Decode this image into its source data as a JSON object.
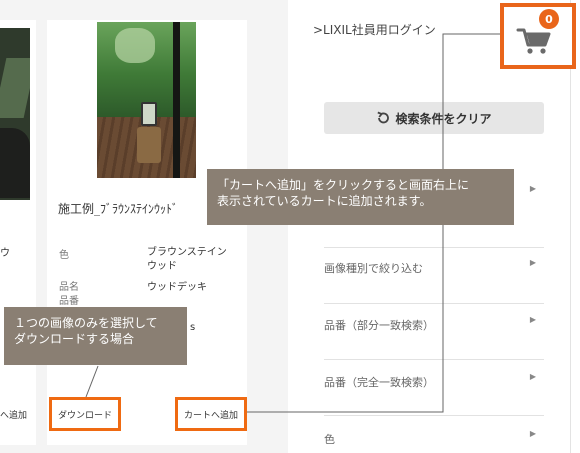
{
  "header": {
    "login_link": ">LIXIL社員用ログイン"
  },
  "cart": {
    "count": "0",
    "icon": "cart-icon",
    "accent_color": "#e9651a"
  },
  "sidebar": {
    "clear_button": "検索条件をクリア",
    "filters": [
      {
        "label": ""
      },
      {
        "label": "画像種別で絞り込む"
      },
      {
        "label": "品番（部分一致検索）"
      },
      {
        "label": "品番（完全一致検索）"
      },
      {
        "label": "色"
      }
    ]
  },
  "product": {
    "title": "施工例_ﾌﾞﾗｳﾝｽﾃｲﾝｳｯﾄﾞ",
    "specs": [
      {
        "label": "色",
        "value": "ブラウンステイン\nウッド"
      },
      {
        "label": "品名",
        "value": "ウッドデッキ"
      },
      {
        "label": "品番",
        "value": ""
      }
    ],
    "trailing_text": "s",
    "download_button": "ダウンロード",
    "add_to_cart_button": "カートへ追加"
  },
  "left_card": {
    "partial_label": "ウ",
    "partial_button": "へ追加"
  },
  "callouts": {
    "cart_tip": "「カートへ追加」をクリックすると画面右上に\n表示されているカートに追加されます。",
    "download_tip": "１つの画像のみを選択して\nダウンロードする場合"
  }
}
